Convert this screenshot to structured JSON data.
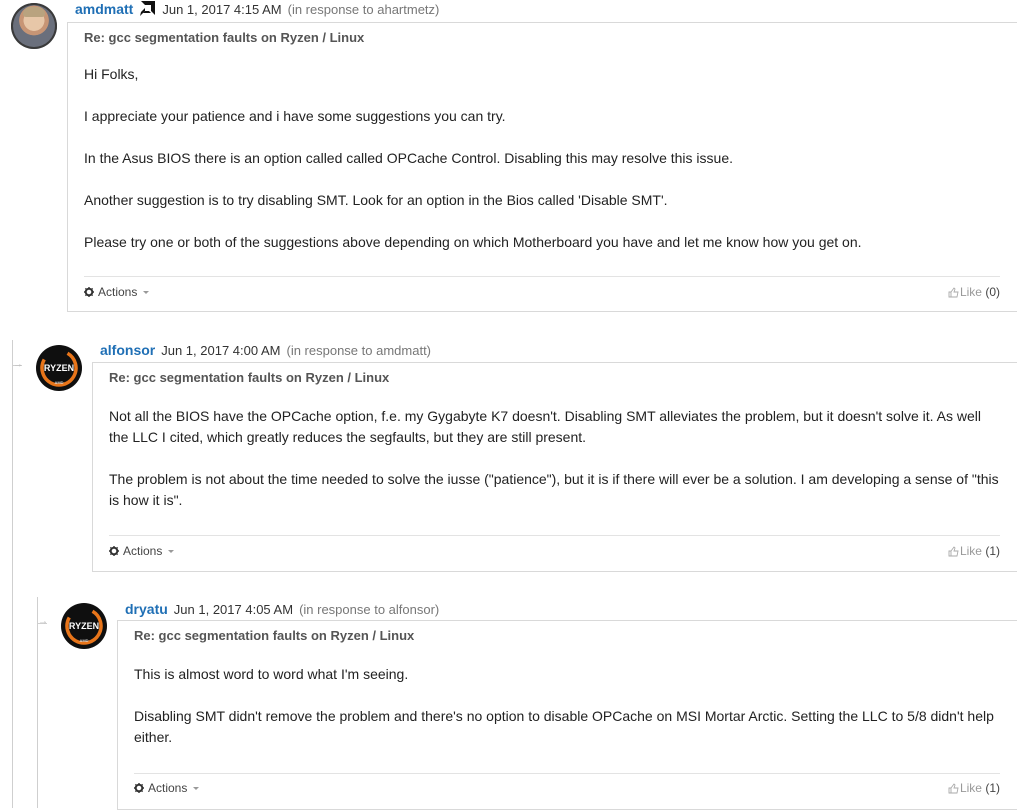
{
  "posts": [
    {
      "author": "amdmatt",
      "avatar_icon": "user-photo-icon",
      "badge_icon": "amd-staff-icon",
      "date": "Jun 1, 2017 4:15 AM",
      "in_response": "(in response to ahartmetz)",
      "subject": "Re: gcc segmentation faults on Ryzen / Linux",
      "paragraphs": [
        "Hi Folks,",
        "I appreciate your patience and i have some suggestions you can try.",
        "In the Asus BIOS there is an option called called OPCache Control. Disabling this may resolve this issue.",
        "Another suggestion is to try disabling SMT. Look for an option in the Bios called 'Disable SMT'.",
        "Please try one or both of the suggestions above depending on which Motherboard you have and let me know how you get on."
      ],
      "actions_label": "Actions",
      "like_label": "Like",
      "like_count": "(0)"
    },
    {
      "author": "alfonsor",
      "avatar_icon": "ryzen-logo-icon",
      "date": "Jun 1, 2017 4:00 AM",
      "in_response": "(in response to amdmatt)",
      "subject": "Re: gcc segmentation faults on Ryzen / Linux",
      "paragraphs": [
        "Not all the BIOS have the OPCache option, f.e. my Gygabyte K7 doesn't. Disabling SMT alleviates the problem, but it doesn't solve it. As well the LLC I cited, which greatly reduces the segfaults, but they are still present.",
        "The problem is not about the time needed to solve the iusse (\"patience\"), but it is if there will ever be a solution. I am developing a sense of \"this is how it is\"."
      ],
      "actions_label": "Actions",
      "like_label": "Like",
      "like_count": "(1)"
    },
    {
      "author": "dryatu",
      "avatar_icon": "ryzen-logo-icon",
      "date": "Jun 1, 2017 4:05 AM",
      "in_response": "(in response to alfonsor)",
      "subject": "Re: gcc segmentation faults on Ryzen / Linux",
      "paragraphs": [
        "This is almost word to word what I'm seeing.",
        "Disabling SMT didn't remove the problem and there's no option to disable OPCache on MSI Mortar Arctic. Setting the LLC to 5/8 didn't help either."
      ],
      "actions_label": "Actions",
      "like_label": "Like",
      "like_count": "(1)"
    }
  ],
  "ryzen_logo": {
    "word": "RYZEN",
    "sub": "AMD"
  },
  "colors": {
    "author_link": "#1f6fb5",
    "border": "#d9d9d9",
    "ryzen_orange": "#e8751a"
  }
}
